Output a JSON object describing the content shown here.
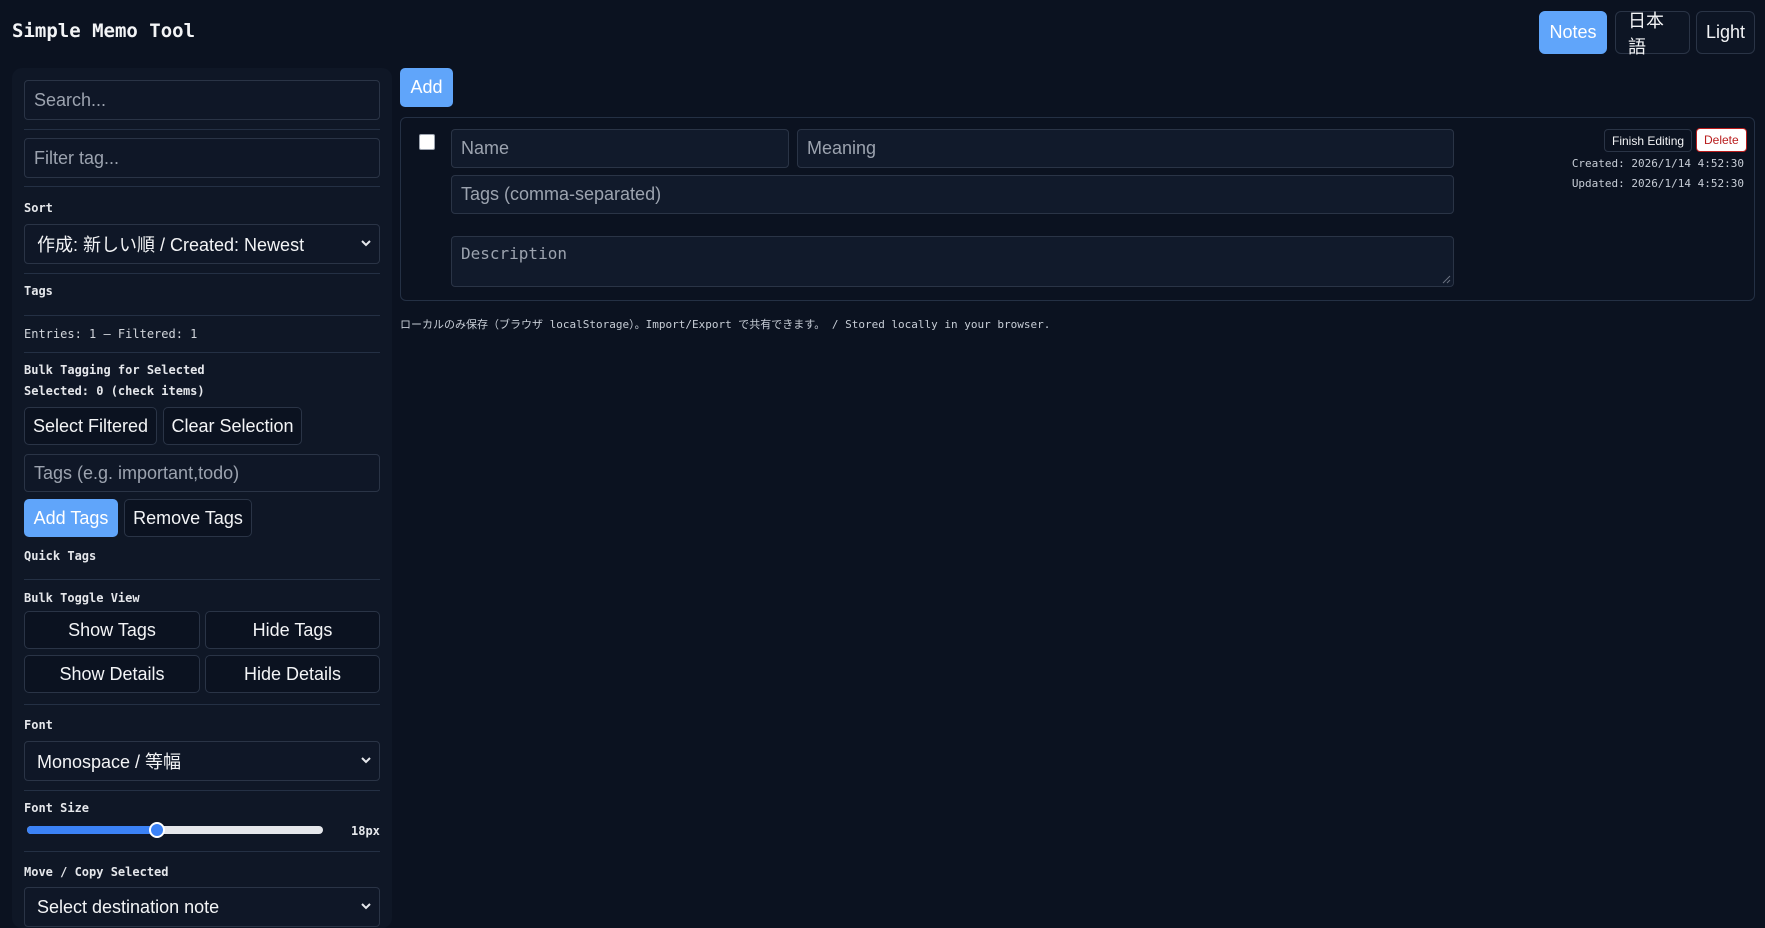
{
  "header": {
    "title": "Simple Memo Tool",
    "buttons": {
      "notes": "Notes",
      "language": "日本語",
      "theme": "Light"
    }
  },
  "sidebar": {
    "search": {
      "placeholder": "Search..."
    },
    "filter_tag": {
      "placeholder": "Filter tag..."
    },
    "sort": {
      "label": "Sort",
      "selected": "作成: 新しい順 / Created: Newest"
    },
    "tags_label": "Tags",
    "entries_text": "Entries: 1 — Filtered: 1",
    "bulk_tagging": {
      "label": "Bulk Tagging for Selected",
      "selected_text": "Selected: 0 (check items)",
      "select_filtered": "Select Filtered",
      "clear_selection": "Clear Selection",
      "tags_input": {
        "placeholder": "Tags (e.g. important,todo)"
      },
      "add_tags": "Add Tags",
      "remove_tags": "Remove Tags"
    },
    "quick_tags_label": "Quick Tags",
    "bulk_toggle": {
      "label": "Bulk Toggle View",
      "show_tags": "Show Tags",
      "hide_tags": "Hide Tags",
      "show_details": "Show Details",
      "hide_details": "Hide Details"
    },
    "font": {
      "label": "Font",
      "selected": "Monospace / 等幅"
    },
    "font_size": {
      "label": "Font Size",
      "value_text": "18px",
      "fraction": 0.44
    },
    "move_copy": {
      "label": "Move / Copy Selected",
      "selected": "Select destination note"
    }
  },
  "main": {
    "add_button": "Add",
    "note": {
      "name_placeholder": "Name",
      "meaning_placeholder": "Meaning",
      "tags_placeholder": "Tags (comma-separated)",
      "description_placeholder": "Description",
      "finish_editing": "Finish Editing",
      "delete": "Delete",
      "created": "Created: 2026/1/14 4:52:30",
      "updated": "Updated: 2026/1/14 4:52:30"
    },
    "footnote": "ローカルのみ保存（ブラウザ localStorage）。Import/Export で共有できます。 / Stored locally in your browser."
  },
  "colors": {
    "background": "#0b1220",
    "panel": "#0f1726",
    "accent": "#60a5fa",
    "danger": "#b91c1c"
  }
}
